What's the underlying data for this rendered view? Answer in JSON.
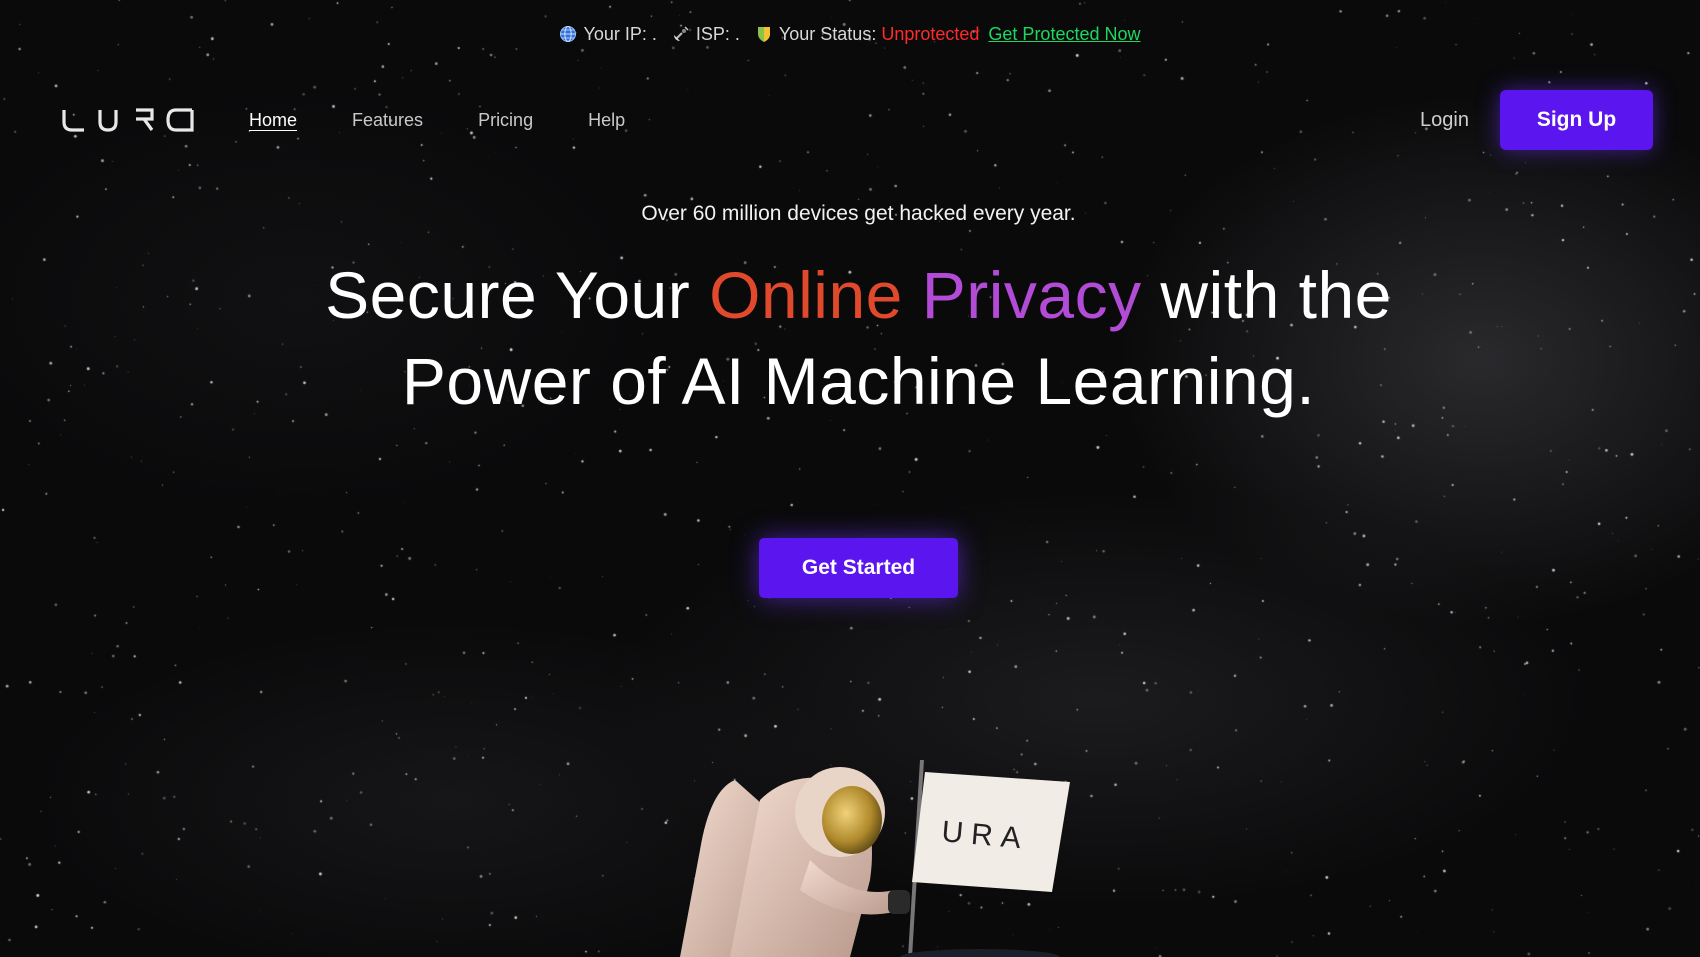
{
  "status_bar": {
    "ip_label": "Your IP: .",
    "isp_label": "ISP: .",
    "status_label": "Your Status:",
    "status_value": "Unprotected",
    "cta_label": "Get Protected Now",
    "status_color": "#ff2a2a",
    "cta_color": "#1ed760"
  },
  "brand": {
    "logo_text": "URA"
  },
  "nav": {
    "items": [
      {
        "label": "Home",
        "active": true
      },
      {
        "label": "Features",
        "active": false
      },
      {
        "label": "Pricing",
        "active": false
      },
      {
        "label": "Help",
        "active": false
      }
    ],
    "login_label": "Login",
    "signup_label": "Sign Up"
  },
  "hero": {
    "tagline": "Over 60 million devices get hacked every year.",
    "headline_part1": "Secure Your",
    "headline_highlight1": "Online",
    "headline_highlight2": "Privacy",
    "headline_part2": "with the Power of AI Machine Learning.",
    "cta_label": "Get Started"
  },
  "illustration": {
    "flag_text": "URA"
  },
  "colors": {
    "accent": "#5b16f0",
    "highlight_orange": "#e0492c",
    "highlight_purple": "#b24bd6",
    "background": "#0a0a0b"
  },
  "icons": [
    "globe-icon",
    "satellite-icon",
    "shield-icon"
  ]
}
